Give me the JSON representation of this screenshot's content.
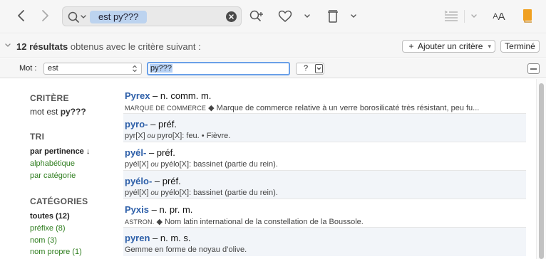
{
  "toolbar": {
    "search_value": "est py???",
    "icons": [
      "chevron-left-icon",
      "chevron-right-icon",
      "search-icon",
      "clear-icon",
      "zoom-in-icon",
      "heart-icon",
      "trash-icon",
      "text-align-icon",
      "font-size-icon",
      "book-icon"
    ],
    "font_size_big": "A",
    "font_size_small": "A"
  },
  "results_bar": {
    "count_label": "12 résultats",
    "criterion_label": "obtenus avec le critère suivant :",
    "add_criterion_button": "Ajouter un critère",
    "done_button": "Terminé"
  },
  "criteria_row": {
    "label": "Mot :",
    "operator_value": "est",
    "pattern_value": "py???",
    "wildcard_value": "?"
  },
  "sidebar": {
    "criteria_title": "CRITÈRE",
    "criteria_prefix": "mot est ",
    "criteria_pattern": "py???",
    "sort_title": "TRI",
    "sort_items": [
      "par pertinence ↓",
      "alphabétique",
      "par catégorie"
    ],
    "categories_title": "CATÉGORIES",
    "categories": [
      "toutes (12)",
      "préfixe (8)",
      "nom (3)",
      "nom propre (1)"
    ]
  },
  "results": [
    {
      "word": "Pyrex",
      "grammar": " – n. comm. m.",
      "tag": "MARQUE DE COMMERCE",
      "desc": " ◆ Marque de commerce relative à un verre borosilicaté très résistant, peu fu..."
    },
    {
      "word": "pyro-",
      "grammar": " – préf.",
      "tag": "",
      "desc": "pyr[X] ou pyro[X]: feu. • Fièvre."
    },
    {
      "word": "pyél-",
      "grammar": " – préf.",
      "tag": "",
      "desc": "pyél[X] ou pyélo[X]: bassinet (partie du rein)."
    },
    {
      "word": "pyélo-",
      "grammar": " – préf.",
      "tag": "",
      "desc": "pyél[X] ou pyélo[X]: bassinet (partie du rein)."
    },
    {
      "word": "Pyxis",
      "grammar": " – n. pr. m.",
      "tag": "ASTRON.",
      "desc": " ◆ Nom latin international de la constellation de la Boussole."
    },
    {
      "word": "pyren",
      "grammar": " – n. m. s.",
      "tag": "",
      "desc": "Gemme en forme de noyau d’olive."
    }
  ],
  "colors": {
    "accent_link": "#2c5ea8",
    "category_link": "#2e7d1e",
    "token_highlight": "#bcd3ef",
    "book_icon": "#f0a020"
  }
}
